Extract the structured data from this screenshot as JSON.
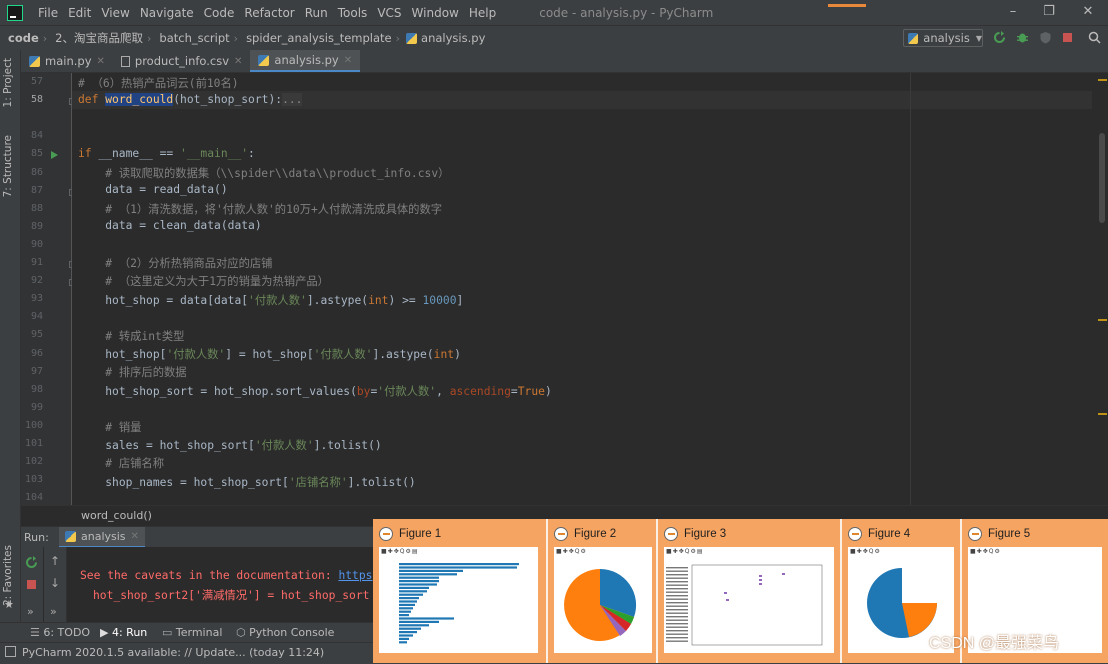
{
  "menu": {
    "items": [
      "File",
      "Edit",
      "View",
      "Navigate",
      "Code",
      "Refactor",
      "Run",
      "Tools",
      "VCS",
      "Window",
      "Help"
    ],
    "title": "code - analysis.py - PyCharm"
  },
  "nav": {
    "crumbs": [
      "code",
      "2、淘宝商品爬取",
      "batch_script",
      "spider_analysis_template",
      "analysis.py"
    ],
    "run_config": "analysis"
  },
  "side": {
    "project": "1: Project",
    "structure": "7: Structure",
    "favorites": "2: Favorites"
  },
  "tabs": [
    {
      "label": "main.py",
      "active": false
    },
    {
      "label": "product_info.csv",
      "active": false
    },
    {
      "label": "analysis.py",
      "active": true
    }
  ],
  "code": {
    "lines": [
      {
        "n": "57"
      },
      {
        "n": "58"
      },
      {
        "n": "84"
      },
      {
        "n": "85"
      },
      {
        "n": "86"
      },
      {
        "n": "87"
      },
      {
        "n": "88"
      },
      {
        "n": "89"
      },
      {
        "n": "90"
      },
      {
        "n": "91"
      },
      {
        "n": "92"
      },
      {
        "n": "93"
      },
      {
        "n": "94"
      },
      {
        "n": "95"
      },
      {
        "n": "96"
      },
      {
        "n": "97"
      },
      {
        "n": "98"
      },
      {
        "n": "99"
      },
      {
        "n": "100"
      },
      {
        "n": "101"
      },
      {
        "n": "102"
      },
      {
        "n": "103"
      },
      {
        "n": "104"
      },
      {
        "n": "105"
      },
      {
        "n": "106"
      }
    ],
    "t57": "# （6）热销产品词云(前10名)",
    "t58_kw": "def ",
    "t58_fn": "word_could",
    "t58_rest": "(hot_shop_sort):",
    "t58_fold": "...",
    "t87_kw": "if ",
    "t87_a": "__name__ == ",
    "t87_s": "'__main__'",
    "t87_b": ":",
    "t88": "# 读取爬取的数据集（\\\\spider\\\\data\\\\product_info.csv）",
    "t89": "data = read_data()",
    "t90": "# （1）清洗数据，将'付款人数'的10万+人付款清洗成具体的数字",
    "t91": "data = clean_data(data)",
    "t93": "# （2）分析热销商品对应的店铺",
    "t94": "# （这里定义为大于1万的销量为热销产品）",
    "t95_a": "hot_shop = data[data[",
    "t95_s": "'付款人数'",
    "t95_b": "].astype(",
    "t95_kw": "int",
    "t95_c": ") >= ",
    "t95_n": "10000",
    "t95_d": "]",
    "t97": "# 转成int类型",
    "t98_a": "hot_shop[",
    "t98_s": "'付款人数'",
    "t98_b": "] = hot_shop[",
    "t98_s2": "'付款人数'",
    "t98_c": "].astype(",
    "t98_kw": "int",
    "t98_d": ")",
    "t99": "# 排序后的数据",
    "t100_a": "hot_shop_sort = hot_shop.sort_values(",
    "t100_p": "by",
    "t100_b": "=",
    "t100_s": "'付款人数'",
    "t100_c": ", ",
    "t100_p2": "ascending",
    "t100_d": "=",
    "t100_kw": "True",
    "t100_e": ")",
    "t102": "# 销量",
    "t103_a": "sales = hot_shop_sort[",
    "t103_s": "'付款人数'",
    "t103_b": "].tolist()",
    "t104": "# 店铺名称",
    "t105_a": "shop_names = hot_shop_sort[",
    "t105_s": "'店铺名称'",
    "t105_b": "].tolist()"
  },
  "footer_crumb": "word_could()",
  "run": {
    "label": "Run:",
    "tab": "analysis",
    "line1_a": "See the caveats in the documentation: ",
    "line1_link": "https",
    "line2": "hot_shop_sort2['满减情况'] = hot_shop_sort"
  },
  "bottom_tabs": [
    "6: TODO",
    "4: Run",
    "Terminal",
    "Python Console"
  ],
  "status": "PyCharm 2020.1.5 available: // Update... (today 11:24)",
  "figures": [
    "Figure 1",
    "Figure 2",
    "Figure 3",
    "Figure 4",
    "Figure 5"
  ],
  "watermark": "CSDN @最强菜鸟",
  "colors": {
    "accent": "#4a88c7",
    "figure_panel": "#f6a462",
    "pie_blue": "#1f77b4",
    "pie_orange": "#ff7f0e"
  }
}
